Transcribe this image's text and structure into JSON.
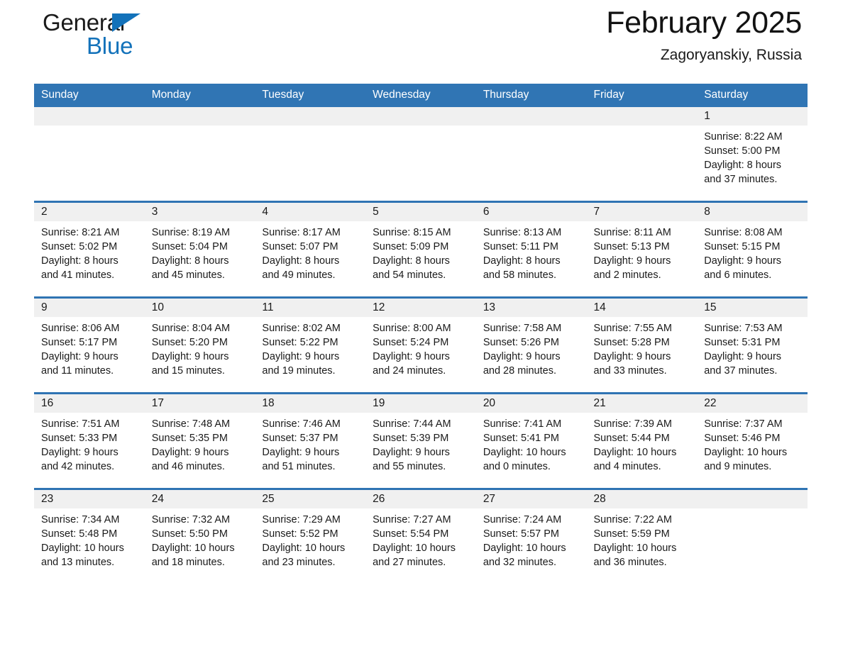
{
  "brand": {
    "line1": "General",
    "line2": "Blue",
    "accent_color": "#1372ba",
    "triangle_icon": "brand-triangle-icon"
  },
  "header": {
    "month_title": "February 2025",
    "location": "Zagoryanskiy, Russia"
  },
  "calendar": {
    "header_bg": "#3075b4",
    "row_divider_color": "#2f74b3",
    "daynum_bg": "#f0f0f0",
    "weekdays": [
      "Sunday",
      "Monday",
      "Tuesday",
      "Wednesday",
      "Thursday",
      "Friday",
      "Saturday"
    ],
    "weeks": [
      [
        {
          "day": "",
          "lines": []
        },
        {
          "day": "",
          "lines": []
        },
        {
          "day": "",
          "lines": []
        },
        {
          "day": "",
          "lines": []
        },
        {
          "day": "",
          "lines": []
        },
        {
          "day": "",
          "lines": []
        },
        {
          "day": "1",
          "lines": [
            "Sunrise: 8:22 AM",
            "Sunset: 5:00 PM",
            "Daylight: 8 hours",
            "and 37 minutes."
          ]
        }
      ],
      [
        {
          "day": "2",
          "lines": [
            "Sunrise: 8:21 AM",
            "Sunset: 5:02 PM",
            "Daylight: 8 hours",
            "and 41 minutes."
          ]
        },
        {
          "day": "3",
          "lines": [
            "Sunrise: 8:19 AM",
            "Sunset: 5:04 PM",
            "Daylight: 8 hours",
            "and 45 minutes."
          ]
        },
        {
          "day": "4",
          "lines": [
            "Sunrise: 8:17 AM",
            "Sunset: 5:07 PM",
            "Daylight: 8 hours",
            "and 49 minutes."
          ]
        },
        {
          "day": "5",
          "lines": [
            "Sunrise: 8:15 AM",
            "Sunset: 5:09 PM",
            "Daylight: 8 hours",
            "and 54 minutes."
          ]
        },
        {
          "day": "6",
          "lines": [
            "Sunrise: 8:13 AM",
            "Sunset: 5:11 PM",
            "Daylight: 8 hours",
            "and 58 minutes."
          ]
        },
        {
          "day": "7",
          "lines": [
            "Sunrise: 8:11 AM",
            "Sunset: 5:13 PM",
            "Daylight: 9 hours",
            "and 2 minutes."
          ]
        },
        {
          "day": "8",
          "lines": [
            "Sunrise: 8:08 AM",
            "Sunset: 5:15 PM",
            "Daylight: 9 hours",
            "and 6 minutes."
          ]
        }
      ],
      [
        {
          "day": "9",
          "lines": [
            "Sunrise: 8:06 AM",
            "Sunset: 5:17 PM",
            "Daylight: 9 hours",
            "and 11 minutes."
          ]
        },
        {
          "day": "10",
          "lines": [
            "Sunrise: 8:04 AM",
            "Sunset: 5:20 PM",
            "Daylight: 9 hours",
            "and 15 minutes."
          ]
        },
        {
          "day": "11",
          "lines": [
            "Sunrise: 8:02 AM",
            "Sunset: 5:22 PM",
            "Daylight: 9 hours",
            "and 19 minutes."
          ]
        },
        {
          "day": "12",
          "lines": [
            "Sunrise: 8:00 AM",
            "Sunset: 5:24 PM",
            "Daylight: 9 hours",
            "and 24 minutes."
          ]
        },
        {
          "day": "13",
          "lines": [
            "Sunrise: 7:58 AM",
            "Sunset: 5:26 PM",
            "Daylight: 9 hours",
            "and 28 minutes."
          ]
        },
        {
          "day": "14",
          "lines": [
            "Sunrise: 7:55 AM",
            "Sunset: 5:28 PM",
            "Daylight: 9 hours",
            "and 33 minutes."
          ]
        },
        {
          "day": "15",
          "lines": [
            "Sunrise: 7:53 AM",
            "Sunset: 5:31 PM",
            "Daylight: 9 hours",
            "and 37 minutes."
          ]
        }
      ],
      [
        {
          "day": "16",
          "lines": [
            "Sunrise: 7:51 AM",
            "Sunset: 5:33 PM",
            "Daylight: 9 hours",
            "and 42 minutes."
          ]
        },
        {
          "day": "17",
          "lines": [
            "Sunrise: 7:48 AM",
            "Sunset: 5:35 PM",
            "Daylight: 9 hours",
            "and 46 minutes."
          ]
        },
        {
          "day": "18",
          "lines": [
            "Sunrise: 7:46 AM",
            "Sunset: 5:37 PM",
            "Daylight: 9 hours",
            "and 51 minutes."
          ]
        },
        {
          "day": "19",
          "lines": [
            "Sunrise: 7:44 AM",
            "Sunset: 5:39 PM",
            "Daylight: 9 hours",
            "and 55 minutes."
          ]
        },
        {
          "day": "20",
          "lines": [
            "Sunrise: 7:41 AM",
            "Sunset: 5:41 PM",
            "Daylight: 10 hours",
            "and 0 minutes."
          ]
        },
        {
          "day": "21",
          "lines": [
            "Sunrise: 7:39 AM",
            "Sunset: 5:44 PM",
            "Daylight: 10 hours",
            "and 4 minutes."
          ]
        },
        {
          "day": "22",
          "lines": [
            "Sunrise: 7:37 AM",
            "Sunset: 5:46 PM",
            "Daylight: 10 hours",
            "and 9 minutes."
          ]
        }
      ],
      [
        {
          "day": "23",
          "lines": [
            "Sunrise: 7:34 AM",
            "Sunset: 5:48 PM",
            "Daylight: 10 hours",
            "and 13 minutes."
          ]
        },
        {
          "day": "24",
          "lines": [
            "Sunrise: 7:32 AM",
            "Sunset: 5:50 PM",
            "Daylight: 10 hours",
            "and 18 minutes."
          ]
        },
        {
          "day": "25",
          "lines": [
            "Sunrise: 7:29 AM",
            "Sunset: 5:52 PM",
            "Daylight: 10 hours",
            "and 23 minutes."
          ]
        },
        {
          "day": "26",
          "lines": [
            "Sunrise: 7:27 AM",
            "Sunset: 5:54 PM",
            "Daylight: 10 hours",
            "and 27 minutes."
          ]
        },
        {
          "day": "27",
          "lines": [
            "Sunrise: 7:24 AM",
            "Sunset: 5:57 PM",
            "Daylight: 10 hours",
            "and 32 minutes."
          ]
        },
        {
          "day": "28",
          "lines": [
            "Sunrise: 7:22 AM",
            "Sunset: 5:59 PM",
            "Daylight: 10 hours",
            "and 36 minutes."
          ]
        },
        {
          "day": "",
          "lines": []
        }
      ]
    ]
  }
}
